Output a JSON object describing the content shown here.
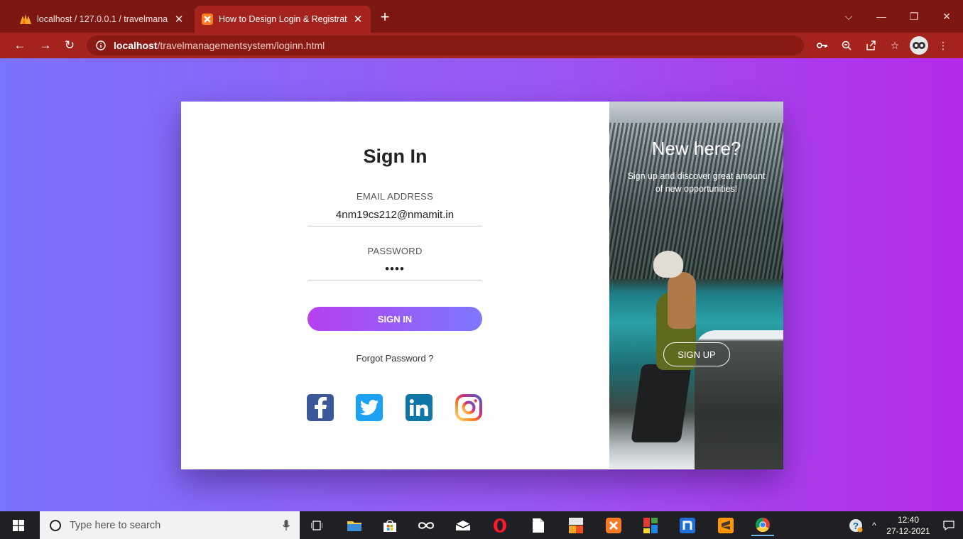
{
  "browser": {
    "tabs": [
      {
        "title": "localhost / 127.0.0.1 / travelmana",
        "favicon": "phpmyadmin-icon",
        "active": false
      },
      {
        "title": "How to Design Login & Registrat",
        "favicon": "xampp-icon",
        "active": true
      }
    ],
    "new_tab": "+",
    "url_host": "localhost",
    "url_path": "/travelmanagementsystem/loginn.html",
    "toolbar_icons": [
      "key-icon",
      "zoom-icon",
      "share-icon",
      "star-icon",
      "profile-avatar",
      "menu-dots-icon"
    ]
  },
  "login": {
    "title": "Sign In",
    "email_label": "EMAIL ADDRESS",
    "email_value": "4nm19cs212@nmamit.in",
    "password_label": "PASSWORD",
    "password_value": "••••",
    "signin_button": "SIGN IN",
    "forgot": "Forgot Password ?",
    "social": [
      "facebook-icon",
      "twitter-icon",
      "linkedin-icon",
      "instagram-icon"
    ]
  },
  "promo": {
    "title": "New here?",
    "subtitle": "Sign up and discover great amount of new opportunities!",
    "signup_button": "SIGN UP"
  },
  "taskbar": {
    "search_placeholder": "Type here to search",
    "time": "12:40",
    "date": "27-12-2021"
  },
  "colors": {
    "tabbar": "#7d1712",
    "toolbar": "#a4231d",
    "gradient_start": "#7a73fb",
    "gradient_end": "#b52be9",
    "button_start": "#b640f0",
    "button_end": "#7b78fb"
  }
}
